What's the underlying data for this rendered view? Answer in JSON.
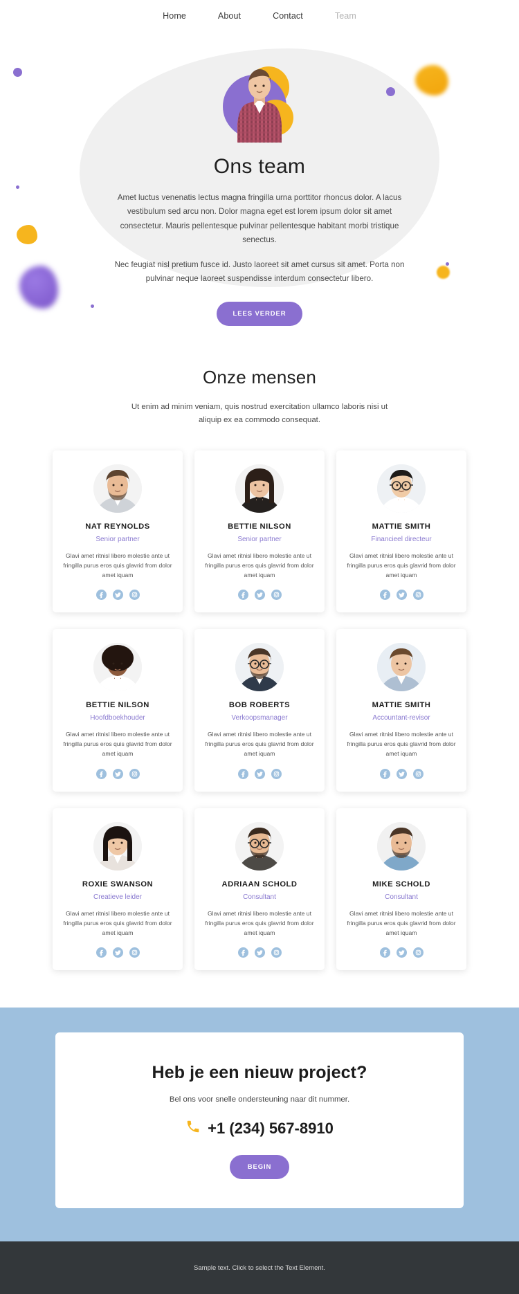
{
  "nav": {
    "items": [
      {
        "label": "Home",
        "active": false
      },
      {
        "label": "About",
        "active": false
      },
      {
        "label": "Contact",
        "active": false
      },
      {
        "label": "Team",
        "active": true
      }
    ]
  },
  "hero": {
    "title": "Ons team",
    "paragraph1": "Amet luctus venenatis lectus magna fringilla urna porttitor rhoncus dolor. A lacus vestibulum sed arcu non. Dolor magna eget est lorem ipsum dolor sit amet consectetur. Mauris pellentesque pulvinar pellentesque habitant morbi tristique senectus.",
    "paragraph2": "Nec feugiat nisl pretium fusce id. Justo laoreet sit amet cursus sit amet. Porta non pulvinar neque laoreet suspendisse interdum consectetur libero.",
    "button_label": "LEES VERDER"
  },
  "team_section": {
    "title": "Onze mensen",
    "subtitle": "Ut enim ad minim veniam, quis nostrud exercitation ullamco laboris nisi ut aliquip ex ea commodo consequat.",
    "shared_description": "Glavi amet ritnisl libero molestie ante ut fringilla purus eros quis glavrid from dolor amet iquam",
    "social_icons": [
      "facebook-icon",
      "twitter-icon",
      "instagram-icon"
    ],
    "members": [
      {
        "name": "NAT REYNOLDS",
        "role": "Senior partner",
        "description": "Glavi amet ritnisl libero molestie ante ut fringilla purus eros quis glavrid from dolor amet iquam"
      },
      {
        "name": "BETTIE NILSON",
        "role": "Senior partner",
        "description": "Glavi amet ritnisl libero molestie ante ut fringilla purus eros quis glavrid from dolor amet iquam"
      },
      {
        "name": "MATTIE SMITH",
        "role": "Financieel directeur",
        "description": "Glavi amet ritnisl libero molestie ante ut fringilla purus eros quis glavrid from dolor amet iquam"
      },
      {
        "name": "BETTIE NILSON",
        "role": "Hoofdboekhouder",
        "description": "Glavi amet ritnisl libero molestie ante ut fringilla purus eros quis glavrid from dolor amet iquam"
      },
      {
        "name": "BOB ROBERTS",
        "role": "Verkoopsmanager",
        "description": "Glavi amet ritnisl libero molestie ante ut fringilla purus eros quis glavrid from dolor amet iquam"
      },
      {
        "name": "MATTIE SMITH",
        "role": "Accountant-revisor",
        "description": "Glavi amet ritnisl libero molestie ante ut fringilla purus eros quis glavrid from dolor amet iquam"
      },
      {
        "name": "ROXIE SWANSON",
        "role": "Creatieve leider",
        "description": "Glavi amet ritnisl libero molestie ante ut fringilla purus eros quis glavrid from dolor amet iquam"
      },
      {
        "name": "ADRIAAN SCHOLD",
        "role": "Consultant",
        "description": "Glavi amet ritnisl libero molestie ante ut fringilla purus eros quis glavrid from dolor amet iquam"
      },
      {
        "name": "MIKE SCHOLD",
        "role": "Consultant",
        "description": "Glavi amet ritnisl libero molestie ante ut fringilla purus eros quis glavrid from dolor amet iquam"
      }
    ]
  },
  "cta": {
    "title": "Heb je een nieuw project?",
    "subtitle": "Bel ons voor snelle ondersteuning naar dit nummer.",
    "phone_icon": "phone-icon",
    "phone": "+1 (234) 567-8910",
    "button_label": "BEGIN"
  },
  "footer": {
    "text": "Sample text. Click to select the Text Element."
  },
  "colors": {
    "accent_purple": "#8a6fd0",
    "accent_yellow": "#f6b51e",
    "cta_band_blue": "#9ec0de",
    "footer_dark": "#33373a",
    "social_blue": "#9ec0de"
  }
}
